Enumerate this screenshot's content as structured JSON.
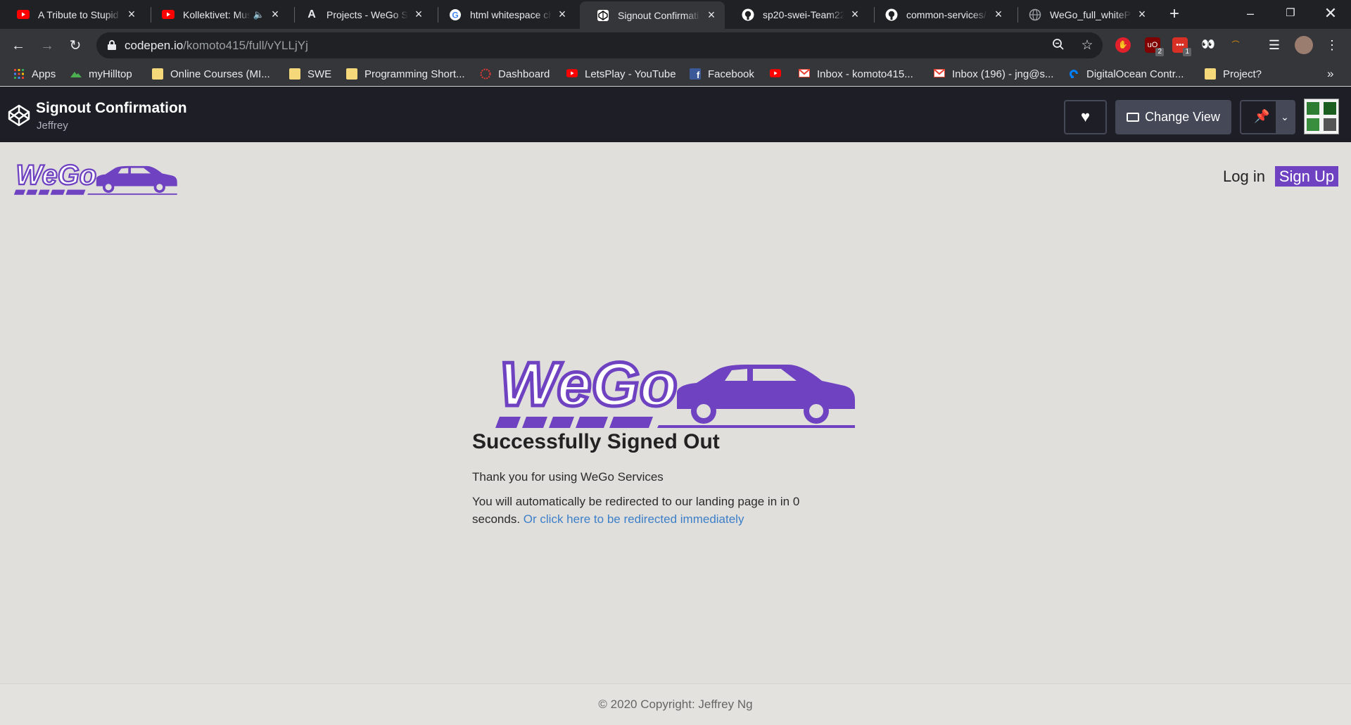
{
  "browser": {
    "tabs": [
      {
        "title": "A Tribute to Stupid",
        "icon": "youtube-icon"
      },
      {
        "title": "Kollektivet: Music",
        "icon": "youtube-icon",
        "muted_indicator": "speaker-icon"
      },
      {
        "title": "Projects - WeGo Se",
        "icon": "a-letter-icon"
      },
      {
        "title": "html whitespace ch",
        "icon": "google-icon"
      },
      {
        "title": "Signout Confirmati",
        "icon": "codepen-icon",
        "active": true
      },
      {
        "title": "sp20-swei-Team22",
        "icon": "github-icon"
      },
      {
        "title": "common-services/",
        "icon": "github-icon"
      },
      {
        "title": "WeGo_full_whitePu",
        "icon": "globe-icon"
      }
    ],
    "url_host": "codepen.io",
    "url_path": "/komoto415/full/vYLLjYj",
    "bookmarks": [
      {
        "label": "Apps",
        "icon": "apps-grid-icon"
      },
      {
        "label": "myHilltop",
        "icon": "hilltop-icon"
      },
      {
        "label": "Online Courses (MI...",
        "icon": "folder-icon"
      },
      {
        "label": "SWE",
        "icon": "folder-icon"
      },
      {
        "label": "Programming Short...",
        "icon": "folder-icon"
      },
      {
        "label": "Dashboard",
        "icon": "dashboard-icon"
      },
      {
        "label": "LetsPlay - YouTube",
        "icon": "youtube-icon"
      },
      {
        "label": "Facebook",
        "icon": "facebook-icon"
      },
      {
        "label": "",
        "icon": "youtube-icon"
      },
      {
        "label": "Inbox - komoto415...",
        "icon": "gmail-icon"
      },
      {
        "label": "Inbox (196) - jng@s...",
        "icon": "gmail-icon"
      },
      {
        "label": "DigitalOcean Contr...",
        "icon": "digitalocean-icon"
      },
      {
        "label": "Project?",
        "icon": "folder-icon"
      }
    ],
    "more_bookmarks": "»",
    "ext_badges": [
      "2",
      "1"
    ]
  },
  "codepen": {
    "title": "Signout Confirmation",
    "user": "Jeffrey",
    "change_view_label": "Change View"
  },
  "site": {
    "logo_text": "WeGo",
    "login_label": "Log in",
    "signup_label": "Sign Up",
    "headline": "Successfully Signed Out",
    "thanks": "Thank you for using WeGo Services",
    "redirect_text": "You will automatically be redirected to our landing page in in 0 seconds.",
    "redirect_link": "Or click here to be redirected immediately",
    "copyright": "© 2020 Copyright: Jeffrey Ng",
    "brand_color": "#6f42c1"
  }
}
